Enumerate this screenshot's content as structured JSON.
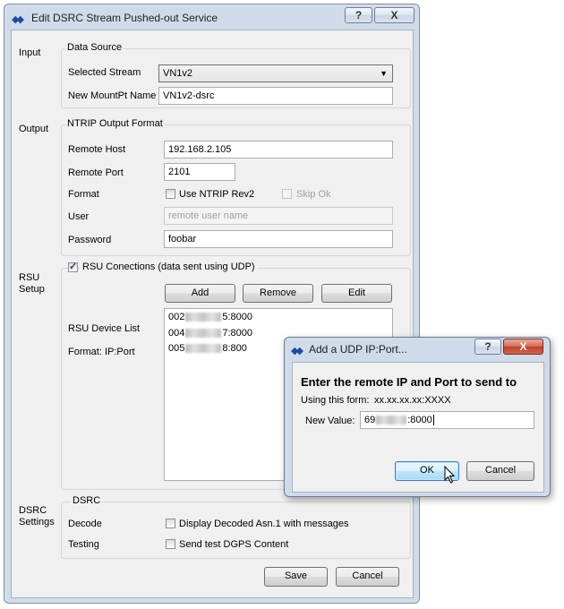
{
  "main_window": {
    "title": "Edit DSRC Stream Pushed-out Service",
    "help_label": "?",
    "close_label": "X",
    "input": {
      "section_label": "Input",
      "group_title": "Data Source",
      "selected_stream_label": "Selected Stream",
      "selected_stream_value": "VN1v2",
      "new_mountpt_label": "New MountPt Name",
      "new_mountpt_value": "VN1v2-dsrc"
    },
    "output": {
      "section_label": "Output",
      "group_title": "NTRIP Output Format",
      "remote_host_label": "Remote Host",
      "remote_host_value": "192.168.2.105",
      "remote_port_label": "Remote Port",
      "remote_port_value": "2101",
      "format_label": "Format",
      "use_ntrip_rev2_label": "Use NTRIP Rev2",
      "skip_ok_label": "Skip Ok",
      "user_label": "User",
      "user_placeholder": "remote user name",
      "password_label": "Password",
      "password_value": "foobar"
    },
    "rsu": {
      "section_label_line1": "RSU",
      "section_label_line2": "Setup",
      "connections_label": "RSU Conections (data sent using UDP)",
      "add_label": "Add",
      "remove_label": "Remove",
      "edit_label": "Edit",
      "device_list_label": "RSU Device List",
      "format_label": "Format: IP:Port",
      "devices": [
        {
          "prefix": "002",
          "suffix": "5:8000"
        },
        {
          "prefix": "004",
          "suffix": "7:8000"
        },
        {
          "prefix": "005",
          "suffix": "8:800"
        }
      ]
    },
    "dsrc": {
      "section_label_line1": "DSRC",
      "section_label_line2": "Settings",
      "group_title": "DSRC",
      "decode_label": "Decode",
      "decode_option": "Display Decoded Asn.1 with messages",
      "testing_label": "Testing",
      "testing_option": "Send test DGPS Content"
    },
    "save_label": "Save",
    "cancel_label": "Cancel"
  },
  "dialog": {
    "title": "Add a UDP IP:Port...",
    "help_label": "?",
    "close_label": "X",
    "heading": "Enter the remote IP and Port to send to",
    "form_label": "Using this form:",
    "form_value": "xx.xx.xx.xx:XXXX",
    "new_value_label": "New Value:",
    "value_prefix": "69",
    "value_suffix": ":8000",
    "ok_label": "OK",
    "cancel_label": "Cancel"
  }
}
